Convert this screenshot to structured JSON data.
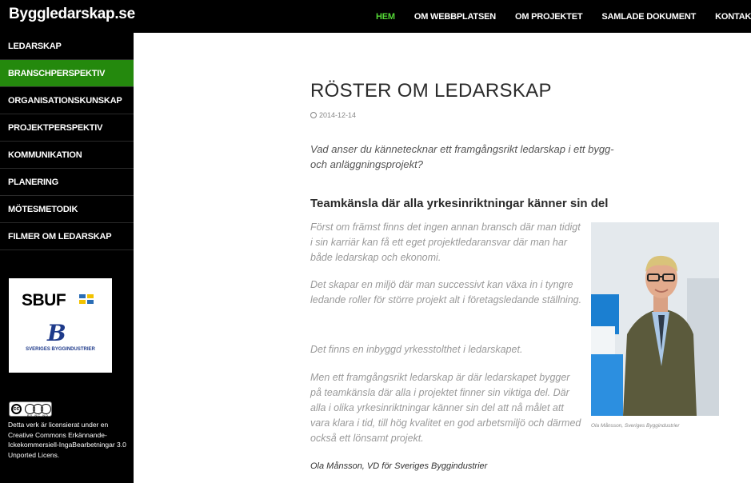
{
  "site": {
    "title": "Byggledarskap.se"
  },
  "nav": {
    "items": [
      {
        "label": "HEM",
        "active": true
      },
      {
        "label": "OM WEBBPLATSEN",
        "active": false
      },
      {
        "label": "OM PROJEKTET",
        "active": false
      },
      {
        "label": "SAMLADE DOKUMENT",
        "active": false
      },
      {
        "label": "KONTAKT",
        "active": false
      }
    ]
  },
  "sidebar": {
    "items": [
      {
        "label": "LEDARSKAP",
        "active": false
      },
      {
        "label": "BRANSCHPERSPEKTIV",
        "active": true
      },
      {
        "label": "ORGANISATIONSKUNSKAP",
        "active": false
      },
      {
        "label": "PROJEKTPERSPEKTIV",
        "active": false
      },
      {
        "label": "KOMMUNIKATION",
        "active": false
      },
      {
        "label": "PLANERING",
        "active": false
      },
      {
        "label": "MÖTESMETODIK",
        "active": false
      },
      {
        "label": "FILMER OM LEDARSKAP",
        "active": false
      }
    ],
    "logos": {
      "sbuf": "SBUF",
      "byggindustrier": "SVERIGES BYGGINDUSTRIER"
    },
    "cc_badge": {
      "small": "BY NC ND"
    },
    "license": {
      "line1": "Detta verk är licensierat under en ",
      "link": "Creative Commons Erkännande-Ickekommersiell-IngaBearbetningar 3.0 Unported Licens."
    }
  },
  "article": {
    "title": "RÖSTER OM LEDARSKAP",
    "date": "2014-12-14",
    "intro": "Vad anser du kännetecknar ett framgångsrikt ledarskap i ett bygg- och anläggningsprojekt?",
    "subheading": "Teamkänsla där alla yrkesinriktningar känner sin del",
    "paragraphs": [
      "Först om främst finns det ingen annan bransch där man tidigt i sin karriär kan få ett eget projektledaransvar där man har både ledarskap och ekonomi.",
      "Det skapar en miljö där man successivt kan växa in i tyngre ledande roller för större projekt alt i företagsledande ställning.",
      "Det finns en inbyggd yrkesstolthet i ledarskapet.",
      "Men ett framgångsrikt ledarskap är där ledarskapet bygger på teamkänsla där alla i projektet finner sin viktiga del. Där alla i olika yrkesinriktningar känner sin del att nå målet att vara klara i tid, till hög kvalitet en god arbetsmiljö och därmed också ett lönsamt projekt."
    ],
    "photo_caption": "Ola Månsson, Sveriges Byggindustrier",
    "signature": "Ola Månsson, VD för Sveriges Byggindustrier"
  },
  "colors": {
    "accent_green": "#24890d",
    "nav_active": "#55d737",
    "bar_bg": "#000000"
  }
}
